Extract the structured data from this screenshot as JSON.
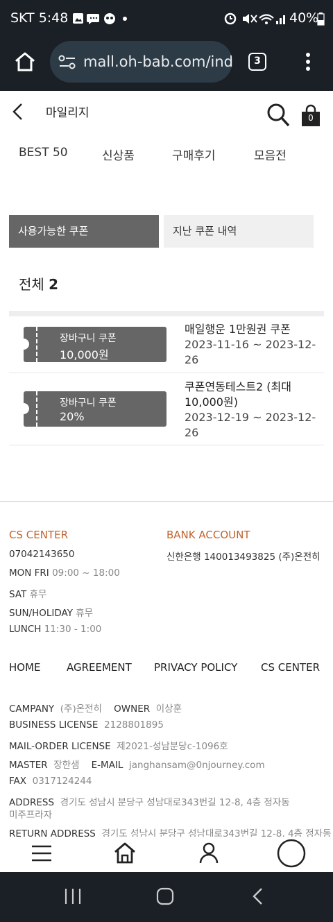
{
  "status_bar": {
    "carrier_time": "SKT 5:48",
    "battery": "40%"
  },
  "browser": {
    "url": "mall.oh-bab.com/inde",
    "tab_count": "3"
  },
  "header": {
    "title": "마일리지",
    "cart_count": "0"
  },
  "nav": [
    "BEST 50",
    "신상품",
    "구매후기",
    "모음전"
  ],
  "coupon_tabs": {
    "available": "사용가능한 쿠폰",
    "past": "지난 쿠폰 내역"
  },
  "total": {
    "label": "전체",
    "count": "2"
  },
  "coupons": [
    {
      "card_label": "장바구니 쿠폰",
      "card_value": "10,000원",
      "name": "매일행운 1만원권 쿠폰",
      "dates": "2023-11-16 ~ 2023-12-26"
    },
    {
      "card_label": "장바구니 쿠폰",
      "card_value": "20%",
      "name": "쿠폰연동테스트2 (최대 10,000원)",
      "dates": "2023-12-19 ~ 2023-12-26"
    }
  ],
  "footer": {
    "cs_center": {
      "heading": "CS CENTER",
      "phone": "07042143650",
      "hours_label": "MON FRI",
      "hours_value": "09:00 ~ 18:00",
      "sat_label": "SAT",
      "sat_value": "휴무",
      "sun_label": "SUN/HOLIDAY",
      "sun_value": "휴무",
      "lunch_label": "LUNCH",
      "lunch_value": "11:30 - 1:00"
    },
    "bank": {
      "heading": "BANK ACCOUNT",
      "account": "신한은행  140013493825  (주)온전히"
    },
    "links": [
      "HOME",
      "AGREEMENT",
      "PRIVACY POLICY",
      "CS CENTER"
    ],
    "company": {
      "company_label": "CAMPANY",
      "company_value": "(주)온전히",
      "owner_label": "OWNER",
      "owner_value": "이상훈",
      "biz_label": "BUSINESS LICENSE",
      "biz_value": "2128801895",
      "mail_label": "MAIL-ORDER LICENSE",
      "mail_value": "제2021-성남분당c-1096호",
      "master_label": "MASTER",
      "master_value": "장한샘",
      "email_label": "E-MAIL",
      "email_value": "janghansam@0njourney.com",
      "fax_label": "FAX",
      "fax_value": "0317124244",
      "address_label": "ADDRESS",
      "address_value": "경기도 성남시 분당구 성남대로343번길 12-8, 4층 정자동",
      "address_value2": "미주프라자",
      "return_label": "RETURN ADDRESS",
      "return_value": "경기도 성남시 분당구 성남대로343번길 12-8, 4층 정자동"
    }
  },
  "colors": {
    "chrome_bg": "#1b2026",
    "url_pill": "#2d3b46",
    "accent": "#c0632d",
    "tab_active": "#666666"
  }
}
